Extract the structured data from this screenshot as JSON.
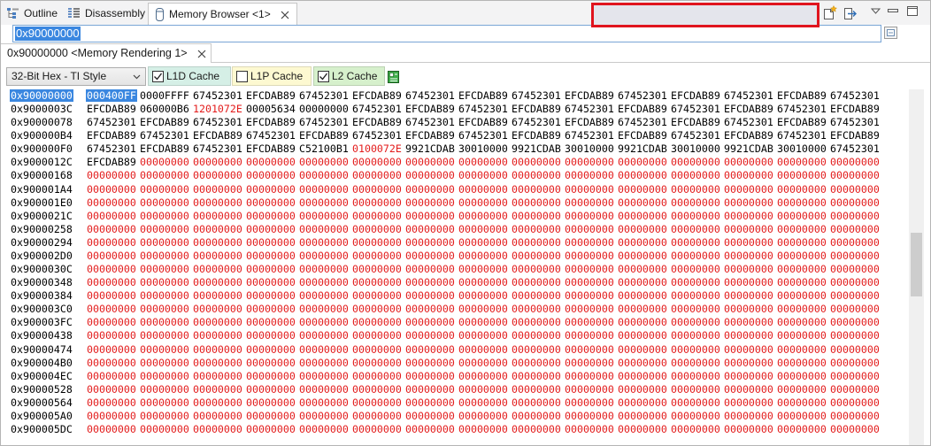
{
  "tabs": [
    {
      "label": "Outline",
      "icon": "outline-icon"
    },
    {
      "label": "Disassembly",
      "icon": "disassembly-icon"
    },
    {
      "label": "Memory Browser <1>",
      "icon": "memory-browser-icon",
      "active": true
    }
  ],
  "view_toolbar_icons": [
    "new-memory-view-icon",
    "export-icon",
    "view-menu-icon",
    "minimize-icon",
    "maximize-icon"
  ],
  "address_input": {
    "value": "0x90000000",
    "selected": true,
    "button_icon": "go-icon"
  },
  "rendering_tab": {
    "label": "0x90000000 <Memory Rendering 1>"
  },
  "format_select": {
    "selected": "32-Bit Hex - TI Style"
  },
  "cache_options": [
    {
      "label": "L1D Cache",
      "checked": true,
      "color": "#d5efe6"
    },
    {
      "label": "L1P Cache",
      "checked": false,
      "color": "#fdf9d1"
    },
    {
      "label": "L2 Cache",
      "checked": true,
      "color": "#d6f0cc"
    }
  ],
  "legend_icon": "cache-legend-icon",
  "colors": {
    "selection_bg": "#3a87e0",
    "changed_text": "#e31b1b",
    "highlight_box": "#e0141e"
  },
  "memory": {
    "selection": {
      "row": 0,
      "word": 0
    },
    "rows": [
      {
        "address": "0x90000000",
        "changed": [],
        "words": [
          "000400FF",
          "0000FFFF",
          "67452301",
          "EFCDAB89",
          "67452301",
          "EFCDAB89",
          "67452301",
          "EFCDAB89",
          "67452301",
          "EFCDAB89",
          "67452301",
          "EFCDAB89",
          "67452301",
          "EFCDAB89",
          "67452301"
        ]
      },
      {
        "address": "0x9000003C",
        "changed": [
          2
        ],
        "words": [
          "EFCDAB89",
          "060000B6",
          "1201072E",
          "00005634",
          "00000000",
          "67452301",
          "EFCDAB89",
          "67452301",
          "EFCDAB89",
          "67452301",
          "EFCDAB89",
          "67452301",
          "EFCDAB89",
          "67452301",
          "EFCDAB89"
        ]
      },
      {
        "address": "0x90000078",
        "changed": [],
        "words": [
          "67452301",
          "EFCDAB89",
          "67452301",
          "EFCDAB89",
          "67452301",
          "EFCDAB89",
          "67452301",
          "EFCDAB89",
          "67452301",
          "EFCDAB89",
          "67452301",
          "EFCDAB89",
          "67452301",
          "EFCDAB89",
          "67452301"
        ]
      },
      {
        "address": "0x900000B4",
        "changed": [],
        "words": [
          "EFCDAB89",
          "67452301",
          "EFCDAB89",
          "67452301",
          "EFCDAB89",
          "67452301",
          "EFCDAB89",
          "67452301",
          "EFCDAB89",
          "67452301",
          "EFCDAB89",
          "67452301",
          "EFCDAB89",
          "67452301",
          "EFCDAB89"
        ]
      },
      {
        "address": "0x900000F0",
        "changed": [
          5
        ],
        "words": [
          "67452301",
          "EFCDAB89",
          "67452301",
          "EFCDAB89",
          "C52100B1",
          "0100072E",
          "9921CDAB",
          "30010000",
          "9921CDAB",
          "30010000",
          "9921CDAB",
          "30010000",
          "9921CDAB",
          "30010000",
          "67452301"
        ]
      },
      {
        "address": "0x9000012C",
        "changed": [
          1,
          2,
          3,
          4,
          5,
          6,
          7,
          8,
          9,
          10,
          11,
          12,
          13,
          14
        ],
        "words": [
          "EFCDAB89",
          "00000000",
          "00000000",
          "00000000",
          "00000000",
          "00000000",
          "00000000",
          "00000000",
          "00000000",
          "00000000",
          "00000000",
          "00000000",
          "00000000",
          "00000000",
          "00000000"
        ]
      },
      {
        "address": "0x90000168",
        "changed": [
          0,
          1,
          2,
          3,
          4,
          5,
          6,
          7,
          8,
          9,
          10,
          11,
          12,
          13,
          14
        ],
        "words": [
          "00000000",
          "00000000",
          "00000000",
          "00000000",
          "00000000",
          "00000000",
          "00000000",
          "00000000",
          "00000000",
          "00000000",
          "00000000",
          "00000000",
          "00000000",
          "00000000",
          "00000000"
        ]
      },
      {
        "address": "0x900001A4",
        "changed": [
          0,
          1,
          2,
          3,
          4,
          5,
          6,
          7,
          8,
          9,
          10,
          11,
          12,
          13,
          14
        ],
        "words": [
          "00000000",
          "00000000",
          "00000000",
          "00000000",
          "00000000",
          "00000000",
          "00000000",
          "00000000",
          "00000000",
          "00000000",
          "00000000",
          "00000000",
          "00000000",
          "00000000",
          "00000000"
        ]
      },
      {
        "address": "0x900001E0",
        "changed": [
          0,
          1,
          2,
          3,
          4,
          5,
          6,
          7,
          8,
          9,
          10,
          11,
          12,
          13,
          14
        ],
        "words": [
          "00000000",
          "00000000",
          "00000000",
          "00000000",
          "00000000",
          "00000000",
          "00000000",
          "00000000",
          "00000000",
          "00000000",
          "00000000",
          "00000000",
          "00000000",
          "00000000",
          "00000000"
        ]
      },
      {
        "address": "0x9000021C",
        "changed": [
          0,
          1,
          2,
          3,
          4,
          5,
          6,
          7,
          8,
          9,
          10,
          11,
          12,
          13,
          14
        ],
        "words": [
          "00000000",
          "00000000",
          "00000000",
          "00000000",
          "00000000",
          "00000000",
          "00000000",
          "00000000",
          "00000000",
          "00000000",
          "00000000",
          "00000000",
          "00000000",
          "00000000",
          "00000000"
        ]
      },
      {
        "address": "0x90000258",
        "changed": [
          0,
          1,
          2,
          3,
          4,
          5,
          6,
          7,
          8,
          9,
          10,
          11,
          12,
          13,
          14
        ],
        "words": [
          "00000000",
          "00000000",
          "00000000",
          "00000000",
          "00000000",
          "00000000",
          "00000000",
          "00000000",
          "00000000",
          "00000000",
          "00000000",
          "00000000",
          "00000000",
          "00000000",
          "00000000"
        ]
      },
      {
        "address": "0x90000294",
        "changed": [
          0,
          1,
          2,
          3,
          4,
          5,
          6,
          7,
          8,
          9,
          10,
          11,
          12,
          13,
          14
        ],
        "words": [
          "00000000",
          "00000000",
          "00000000",
          "00000000",
          "00000000",
          "00000000",
          "00000000",
          "00000000",
          "00000000",
          "00000000",
          "00000000",
          "00000000",
          "00000000",
          "00000000",
          "00000000"
        ]
      },
      {
        "address": "0x900002D0",
        "changed": [
          0,
          1,
          2,
          3,
          4,
          5,
          6,
          7,
          8,
          9,
          10,
          11,
          12,
          13,
          14
        ],
        "words": [
          "00000000",
          "00000000",
          "00000000",
          "00000000",
          "00000000",
          "00000000",
          "00000000",
          "00000000",
          "00000000",
          "00000000",
          "00000000",
          "00000000",
          "00000000",
          "00000000",
          "00000000"
        ]
      },
      {
        "address": "0x9000030C",
        "changed": [
          0,
          1,
          2,
          3,
          4,
          5,
          6,
          7,
          8,
          9,
          10,
          11,
          12,
          13,
          14
        ],
        "words": [
          "00000000",
          "00000000",
          "00000000",
          "00000000",
          "00000000",
          "00000000",
          "00000000",
          "00000000",
          "00000000",
          "00000000",
          "00000000",
          "00000000",
          "00000000",
          "00000000",
          "00000000"
        ]
      },
      {
        "address": "0x90000348",
        "changed": [
          0,
          1,
          2,
          3,
          4,
          5,
          6,
          7,
          8,
          9,
          10,
          11,
          12,
          13,
          14
        ],
        "words": [
          "00000000",
          "00000000",
          "00000000",
          "00000000",
          "00000000",
          "00000000",
          "00000000",
          "00000000",
          "00000000",
          "00000000",
          "00000000",
          "00000000",
          "00000000",
          "00000000",
          "00000000"
        ]
      },
      {
        "address": "0x90000384",
        "changed": [
          0,
          1,
          2,
          3,
          4,
          5,
          6,
          7,
          8,
          9,
          10,
          11,
          12,
          13,
          14
        ],
        "words": [
          "00000000",
          "00000000",
          "00000000",
          "00000000",
          "00000000",
          "00000000",
          "00000000",
          "00000000",
          "00000000",
          "00000000",
          "00000000",
          "00000000",
          "00000000",
          "00000000",
          "00000000"
        ]
      },
      {
        "address": "0x900003C0",
        "changed": [
          0,
          1,
          2,
          3,
          4,
          5,
          6,
          7,
          8,
          9,
          10,
          11,
          12,
          13,
          14
        ],
        "words": [
          "00000000",
          "00000000",
          "00000000",
          "00000000",
          "00000000",
          "00000000",
          "00000000",
          "00000000",
          "00000000",
          "00000000",
          "00000000",
          "00000000",
          "00000000",
          "00000000",
          "00000000"
        ]
      },
      {
        "address": "0x900003FC",
        "changed": [
          0,
          1,
          2,
          3,
          4,
          5,
          6,
          7,
          8,
          9,
          10,
          11,
          12,
          13,
          14
        ],
        "words": [
          "00000000",
          "00000000",
          "00000000",
          "00000000",
          "00000000",
          "00000000",
          "00000000",
          "00000000",
          "00000000",
          "00000000",
          "00000000",
          "00000000",
          "00000000",
          "00000000",
          "00000000"
        ]
      },
      {
        "address": "0x90000438",
        "changed": [
          0,
          1,
          2,
          3,
          4,
          5,
          6,
          7,
          8,
          9,
          10,
          11,
          12,
          13,
          14
        ],
        "words": [
          "00000000",
          "00000000",
          "00000000",
          "00000000",
          "00000000",
          "00000000",
          "00000000",
          "00000000",
          "00000000",
          "00000000",
          "00000000",
          "00000000",
          "00000000",
          "00000000",
          "00000000"
        ]
      },
      {
        "address": "0x90000474",
        "changed": [
          0,
          1,
          2,
          3,
          4,
          5,
          6,
          7,
          8,
          9,
          10,
          11,
          12,
          13,
          14
        ],
        "words": [
          "00000000",
          "00000000",
          "00000000",
          "00000000",
          "00000000",
          "00000000",
          "00000000",
          "00000000",
          "00000000",
          "00000000",
          "00000000",
          "00000000",
          "00000000",
          "00000000",
          "00000000"
        ]
      },
      {
        "address": "0x900004B0",
        "changed": [
          0,
          1,
          2,
          3,
          4,
          5,
          6,
          7,
          8,
          9,
          10,
          11,
          12,
          13,
          14
        ],
        "words": [
          "00000000",
          "00000000",
          "00000000",
          "00000000",
          "00000000",
          "00000000",
          "00000000",
          "00000000",
          "00000000",
          "00000000",
          "00000000",
          "00000000",
          "00000000",
          "00000000",
          "00000000"
        ]
      },
      {
        "address": "0x900004EC",
        "changed": [
          0,
          1,
          2,
          3,
          4,
          5,
          6,
          7,
          8,
          9,
          10,
          11,
          12,
          13,
          14
        ],
        "words": [
          "00000000",
          "00000000",
          "00000000",
          "00000000",
          "00000000",
          "00000000",
          "00000000",
          "00000000",
          "00000000",
          "00000000",
          "00000000",
          "00000000",
          "00000000",
          "00000000",
          "00000000"
        ]
      },
      {
        "address": "0x90000528",
        "changed": [
          0,
          1,
          2,
          3,
          4,
          5,
          6,
          7,
          8,
          9,
          10,
          11,
          12,
          13,
          14
        ],
        "words": [
          "00000000",
          "00000000",
          "00000000",
          "00000000",
          "00000000",
          "00000000",
          "00000000",
          "00000000",
          "00000000",
          "00000000",
          "00000000",
          "00000000",
          "00000000",
          "00000000",
          "00000000"
        ]
      },
      {
        "address": "0x90000564",
        "changed": [
          0,
          1,
          2,
          3,
          4,
          5,
          6,
          7,
          8,
          9,
          10,
          11,
          12,
          13,
          14
        ],
        "words": [
          "00000000",
          "00000000",
          "00000000",
          "00000000",
          "00000000",
          "00000000",
          "00000000",
          "00000000",
          "00000000",
          "00000000",
          "00000000",
          "00000000",
          "00000000",
          "00000000",
          "00000000"
        ]
      },
      {
        "address": "0x900005A0",
        "changed": [
          0,
          1,
          2,
          3,
          4,
          5,
          6,
          7,
          8,
          9,
          10,
          11,
          12,
          13,
          14
        ],
        "words": [
          "00000000",
          "00000000",
          "00000000",
          "00000000",
          "00000000",
          "00000000",
          "00000000",
          "00000000",
          "00000000",
          "00000000",
          "00000000",
          "00000000",
          "00000000",
          "00000000",
          "00000000"
        ]
      },
      {
        "address": "0x900005DC",
        "changed": [
          0,
          1,
          2,
          3,
          4,
          5,
          6,
          7,
          8,
          9,
          10,
          11,
          12,
          13,
          14
        ],
        "words": [
          "00000000",
          "00000000",
          "00000000",
          "00000000",
          "00000000",
          "00000000",
          "00000000",
          "00000000",
          "00000000",
          "00000000",
          "00000000",
          "00000000",
          "00000000",
          "00000000",
          "00000000"
        ]
      }
    ]
  },
  "scrollbar": {
    "position": 0.49,
    "thumb_fraction": 0.18
  }
}
